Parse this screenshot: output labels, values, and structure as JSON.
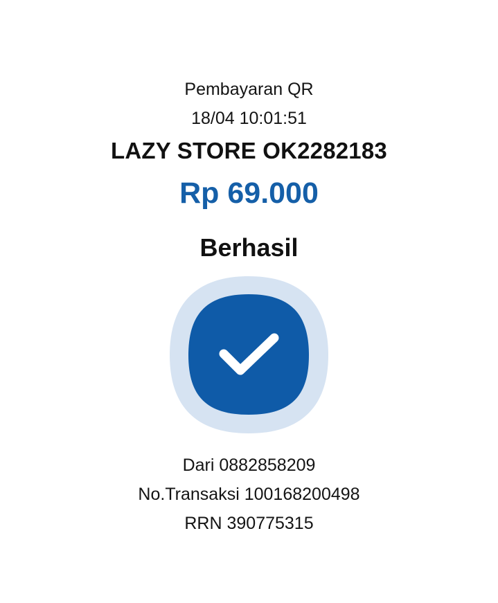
{
  "receipt": {
    "payment_type": "Pembayaran QR",
    "datetime": "18/04 10:01:51",
    "merchant": "LAZY STORE OK2282183",
    "amount": "Rp 69.000",
    "status": "Berhasil",
    "status_icon": "checkmark-icon",
    "from_label": "Dari",
    "from_value": "0882858209",
    "transaction_label": "No.Transaksi",
    "transaction_value": "100168200498",
    "rrn_label": "RRN",
    "rrn_value": "390775315"
  },
  "colors": {
    "accent": "#155fa8",
    "badge_outer": "#d6e3f2",
    "badge_inner": "#0f5ba8",
    "text": "#111111"
  }
}
